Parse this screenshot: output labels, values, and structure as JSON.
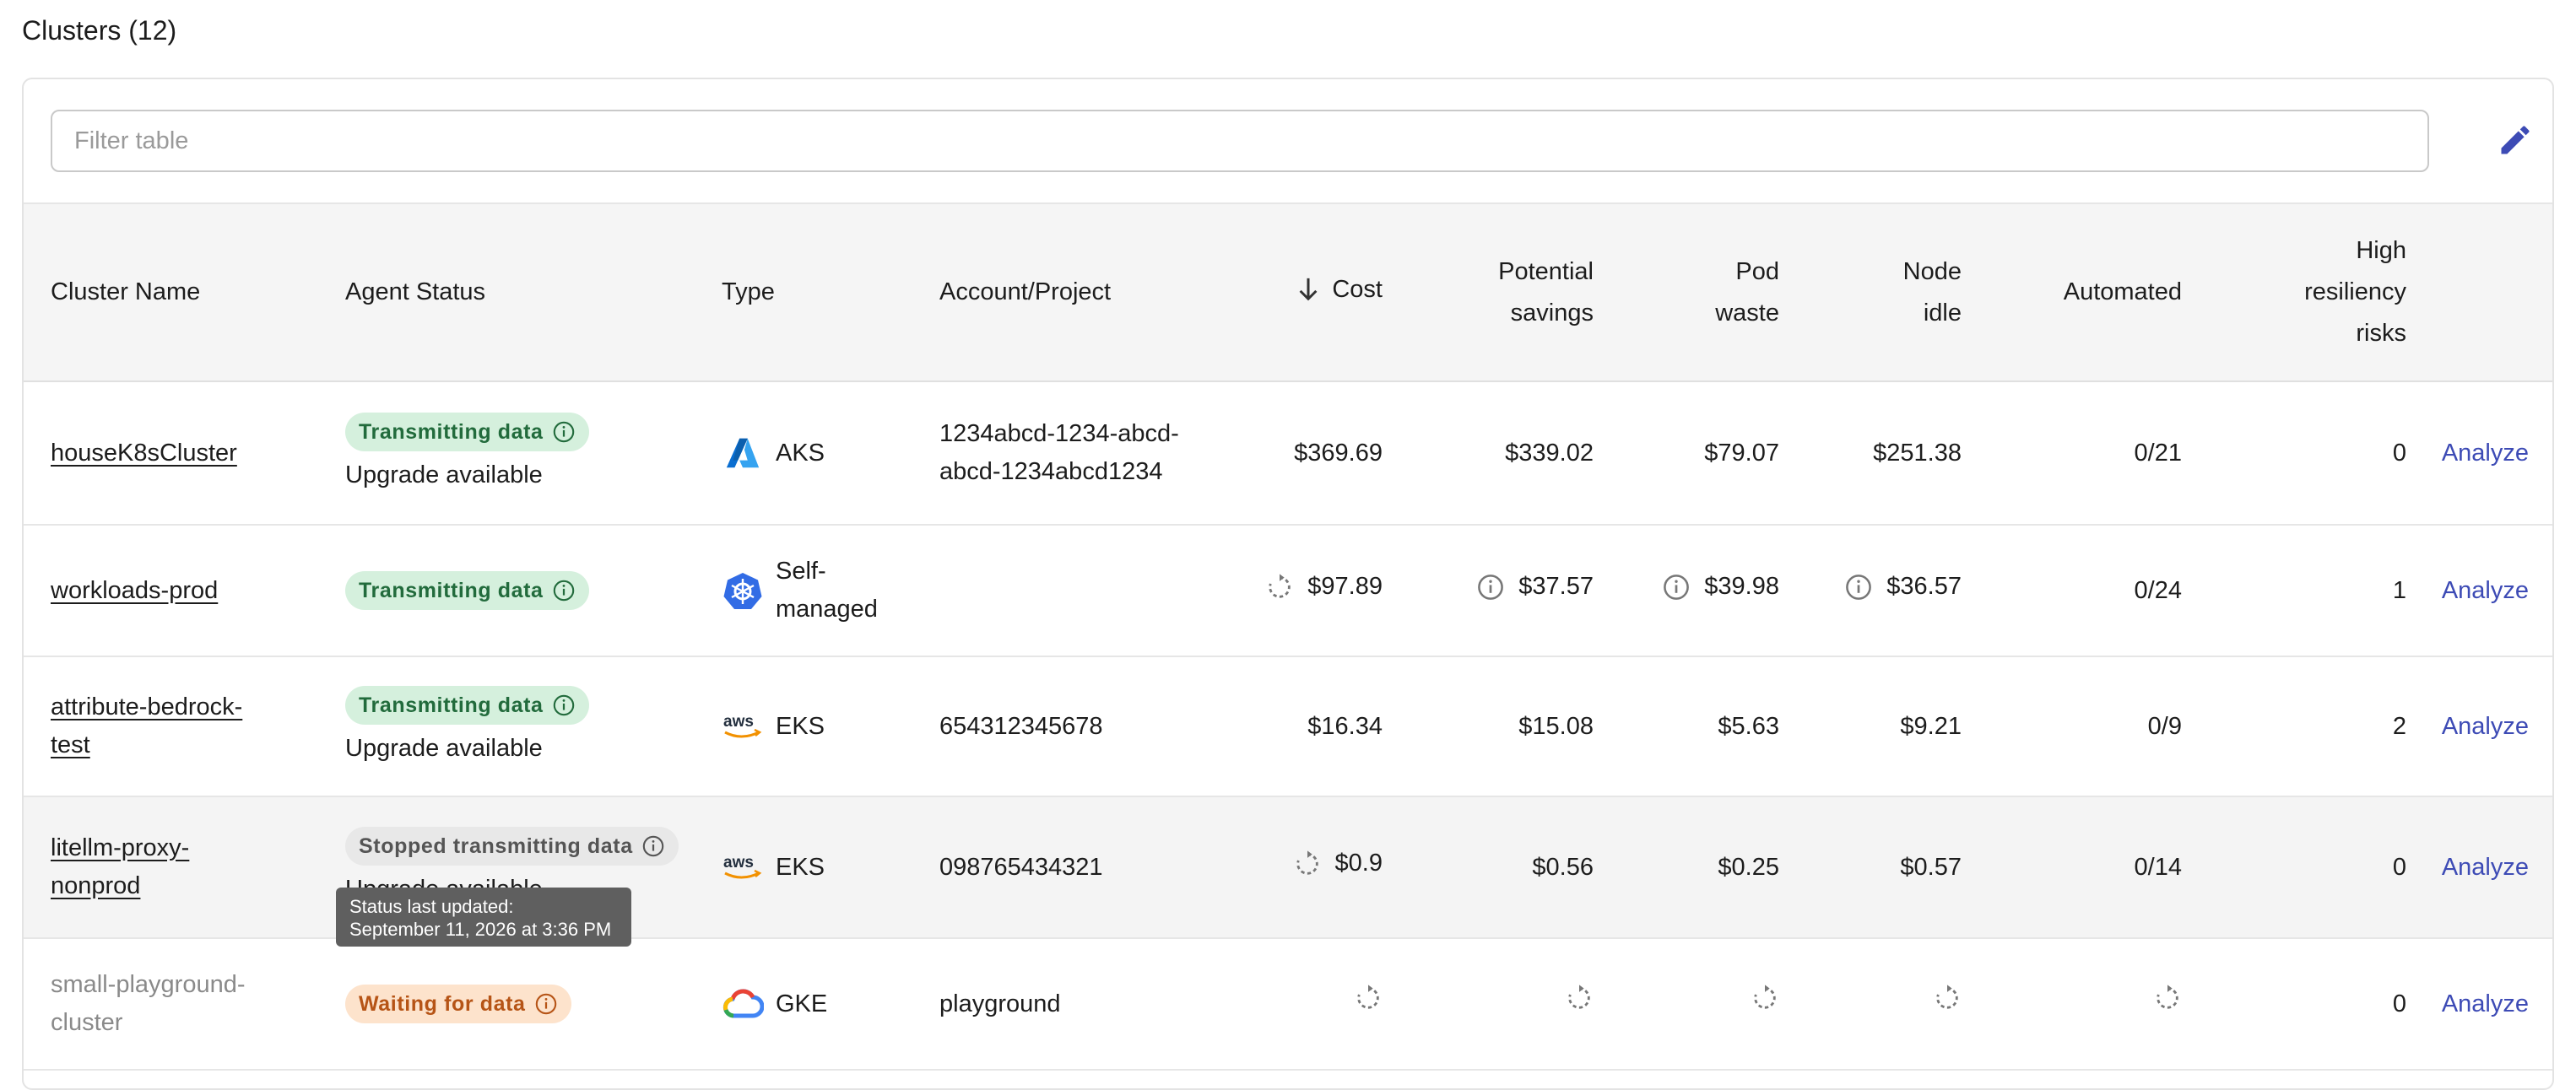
{
  "page": {
    "title": "Clusters (12)"
  },
  "filter": {
    "placeholder": "Filter table"
  },
  "toolbar": {
    "edit_icon": "pencil-icon"
  },
  "colors": {
    "accent": "#3d4bb5",
    "green_badge_bg": "#d5f0dd",
    "green_badge_text": "#226b3c",
    "orange_badge_bg": "#fde3cc",
    "orange_badge_text": "#b65416"
  },
  "columns": {
    "name": "Cluster Name",
    "agent": "Agent Status",
    "type": "Type",
    "account": "Account/Project",
    "cost": "Cost",
    "savings_1": "Potential",
    "savings_2": "savings",
    "pod_1": "Pod",
    "pod_2": "waste",
    "node_1": "Node",
    "node_2": "idle",
    "automated": "Automated",
    "risk_1": "High",
    "risk_2": "resiliency",
    "risk_3": "risks"
  },
  "rows": [
    {
      "name": "houseK8sCluster",
      "status": "Transmitting data",
      "sub": "Upgrade available",
      "type": "AKS",
      "account_1": "1234abcd-1234-abcd-",
      "account_2": "abcd-1234abcd1234",
      "cost": "$369.69",
      "savings": "$339.02",
      "pod": "$79.07",
      "node": "$251.38",
      "automated": "0/21",
      "risks": "0",
      "action": "Analyze"
    },
    {
      "name": "workloads-prod",
      "status": "Transmitting data",
      "type_1": "Self-",
      "type_2": "managed",
      "account": "",
      "cost": "$97.89",
      "savings": "$37.57",
      "pod": "$39.98",
      "node": "$36.57",
      "automated": "0/24",
      "risks": "1",
      "action": "Analyze"
    },
    {
      "name_1": "attribute-bedrock-",
      "name_2": "test",
      "status": "Transmitting data",
      "sub": "Upgrade available",
      "type": "EKS",
      "account": "654312345678",
      "cost": "$16.34",
      "savings": "$15.08",
      "pod": "$5.63",
      "node": "$9.21",
      "automated": "0/9",
      "risks": "2",
      "action": "Analyze"
    },
    {
      "name_1": "litellm-proxy-",
      "name_2": "nonprod",
      "status": "Stopped transmitting data",
      "sub": "Upgrade available",
      "type": "EKS",
      "account": "098765434321",
      "cost": "$0.9",
      "savings": "$0.56",
      "pod": "$0.25",
      "node": "$0.57",
      "automated": "0/14",
      "risks": "0",
      "action": "Analyze"
    },
    {
      "name_1": "small-playground-",
      "name_2": "cluster",
      "status": "Waiting for data",
      "type": "GKE",
      "account": "playground",
      "risks": "0",
      "action": "Analyze"
    }
  ],
  "tooltip": {
    "line_1": "Status last updated:",
    "line_2": "September 11, 2026 at 3:36 PM"
  }
}
